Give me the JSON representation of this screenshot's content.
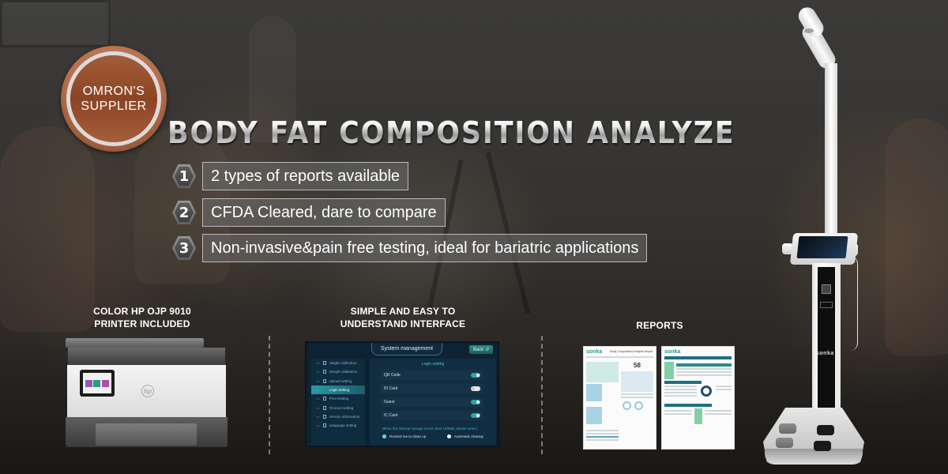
{
  "badge": {
    "line1": "OMRON'S",
    "line2": "SUPPLIER",
    "color": "#a15c39"
  },
  "title": "BODY FAT COMPOSITION ANALYZER",
  "features": [
    {
      "number": "1",
      "text": "2 types of reports available"
    },
    {
      "number": "2",
      "text": "CFDA Cleared, dare to compare"
    },
    {
      "number": "3",
      "text": "Non-invasive&pain free testing, ideal for bariatric applications"
    }
  ],
  "sections": {
    "printer": {
      "caption_line1": "COLOR HP OJP 9010",
      "caption_line2": "PRINTER INCLUDED",
      "logo": "hp"
    },
    "interface": {
      "caption_line1": "SIMPLE AND EASY TO",
      "caption_line2": "UNDERSTAND INTERFACE",
      "screen": {
        "header": "System management",
        "back_button": "Back ↺",
        "sidebar": [
          {
            "label": "Height calibration",
            "active": false
          },
          {
            "label": "Weight calibration",
            "active": false
          },
          {
            "label": "Upload setting",
            "active": false
          },
          {
            "label": "Login setting",
            "active": true
          },
          {
            "label": "Print Setting",
            "active": false
          },
          {
            "label": "Timeout setting",
            "active": false
          },
          {
            "label": "Version information",
            "active": false
          },
          {
            "label": "Language setting",
            "active": false
          }
        ],
        "tab": "Login setting",
        "rows": [
          {
            "label": "QR Code",
            "on": true
          },
          {
            "label": "ID Card",
            "on": false
          },
          {
            "label": "Guest",
            "on": true
          },
          {
            "label": "IC Card",
            "on": true
          }
        ],
        "storage_note": "When the internal storage is less than 100MB, please select:",
        "radio_options": [
          {
            "label": "Remind me to clean up",
            "selected": true
          },
          {
            "label": "Automatic cleanup",
            "selected": false
          }
        ]
      }
    },
    "reports": {
      "caption": "REPORTS",
      "report1": {
        "brand": "sonka",
        "title": "Body Composition Analysis Report",
        "score": "58"
      },
      "report2": {
        "brand": "sonka"
      }
    }
  },
  "device": {
    "brand": "sonka"
  }
}
